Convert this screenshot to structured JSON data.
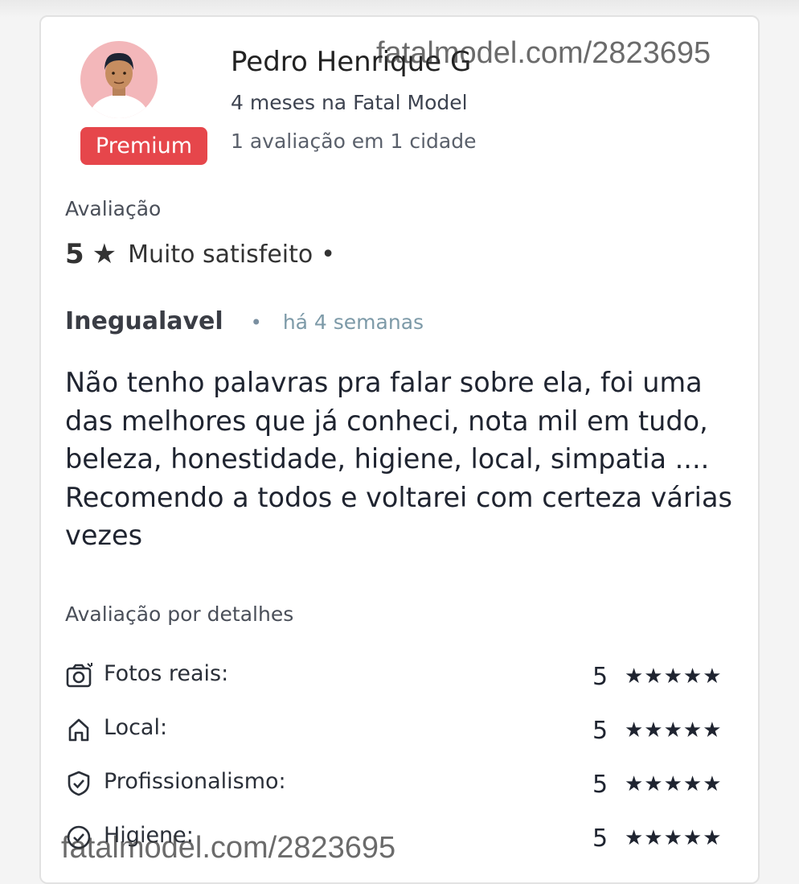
{
  "reviewer": {
    "name": "Pedro Henrique G",
    "tenure": "4 meses na Fatal Model",
    "review_count": "1 avaliação em 1 cidade",
    "badge": "Premium"
  },
  "rating": {
    "label": "Avaliação",
    "score": "5",
    "star": "★",
    "text": "Muito satisfeito",
    "dot": "•"
  },
  "review": {
    "title": "Inegualavel",
    "dot": "•",
    "date": "há 4 semanas",
    "body": "Não tenho palavras pra falar sobre ela, foi uma das melhores que já conheci, nota mil em tudo, beleza, honestidade, higiene, local, simpatia .... Recomendo a todos e voltarei com certeza várias vezes"
  },
  "details": {
    "label": "Avaliação por detalhes",
    "items": [
      {
        "label": "Fotos reais:",
        "score": "5",
        "stars": "★★★★★",
        "icon": "camera-icon"
      },
      {
        "label": "Local:",
        "score": "5",
        "stars": "★★★★★",
        "icon": "home-icon"
      },
      {
        "label": "Profissionalismo:",
        "score": "5",
        "stars": "★★★★★",
        "icon": "shield-check-icon"
      },
      {
        "label": "Higiene:",
        "score": "5",
        "stars": "★★★★★",
        "icon": "check-circle-icon"
      }
    ]
  },
  "watermark": "fatalmodel.com/2823695",
  "colors": {
    "premium_badge": "#e6464b",
    "avatar_bg": "#f3b7ba",
    "date_text": "#7d9aa8"
  }
}
